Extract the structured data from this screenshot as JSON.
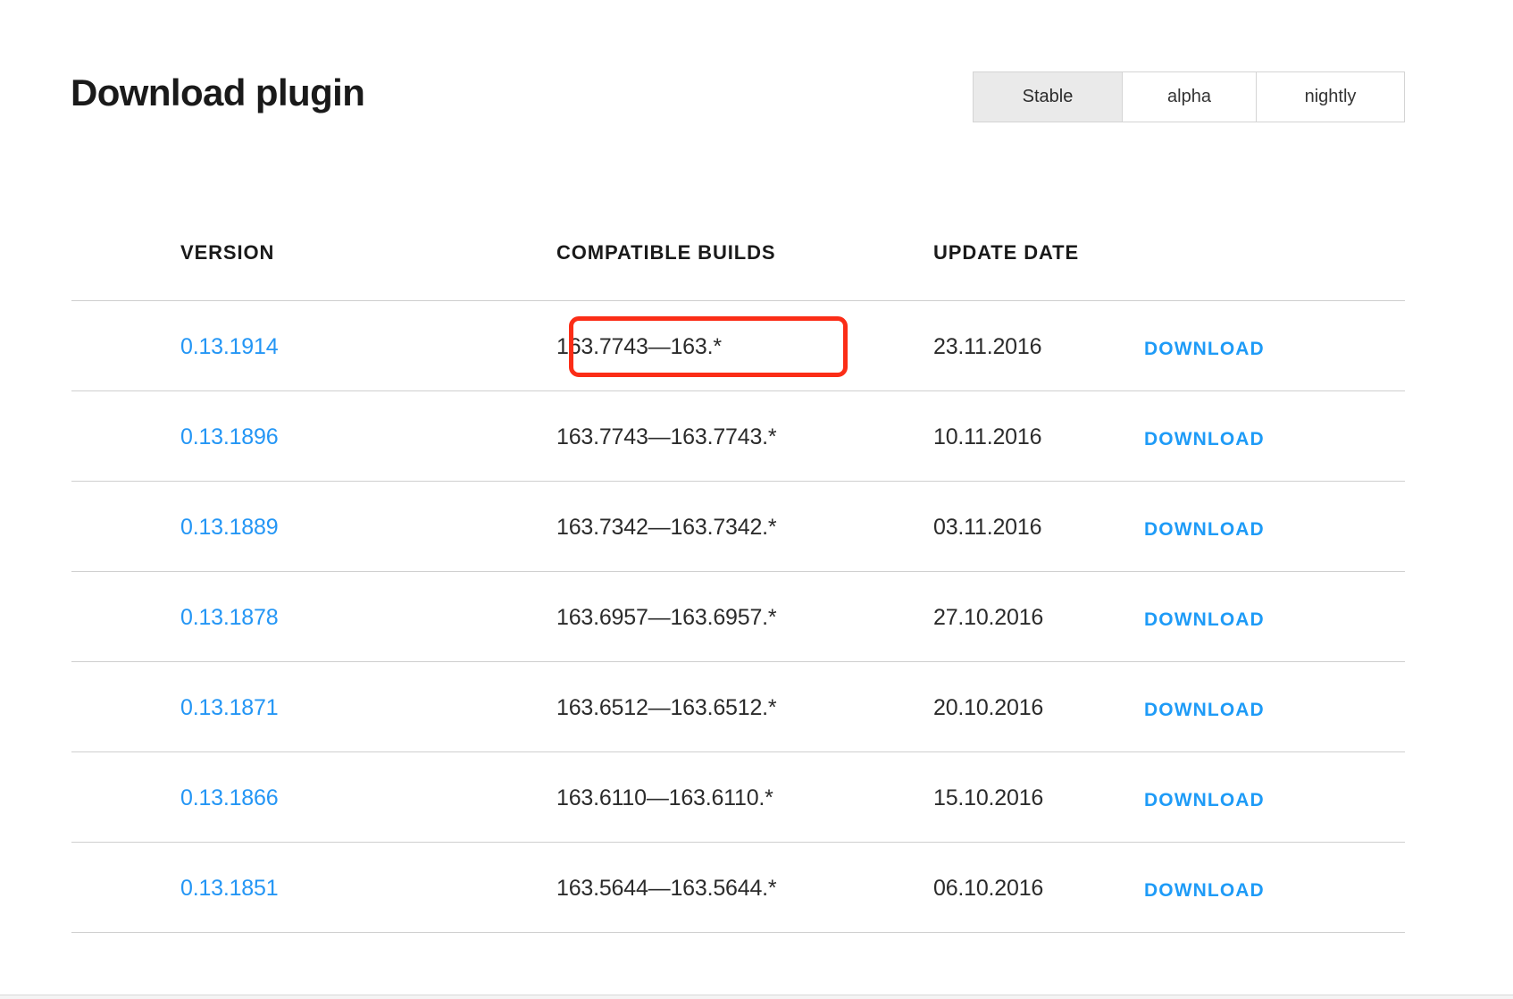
{
  "header": {
    "title": "Download plugin"
  },
  "channel_tabs": {
    "items": [
      {
        "label": "Stable",
        "active": true
      },
      {
        "label": "alpha",
        "active": false
      },
      {
        "label": "nightly",
        "active": false
      }
    ]
  },
  "table": {
    "columns": [
      "VERSION",
      "COMPATIBLE BUILDS",
      "UPDATE DATE"
    ],
    "action_label": "DOWNLOAD",
    "rows": [
      {
        "version": "0.13.1914",
        "compatible_builds": "163.7743—163.*",
        "update_date": "23.11.2016",
        "action": "DOWNLOAD",
        "highlighted": true
      },
      {
        "version": "0.13.1896",
        "compatible_builds": "163.7743—163.7743.*",
        "update_date": "10.11.2016",
        "action": "DOWNLOAD",
        "highlighted": false
      },
      {
        "version": "0.13.1889",
        "compatible_builds": "163.7342—163.7342.*",
        "update_date": "03.11.2016",
        "action": "DOWNLOAD",
        "highlighted": false
      },
      {
        "version": "0.13.1878",
        "compatible_builds": "163.6957—163.6957.*",
        "update_date": "27.10.2016",
        "action": "DOWNLOAD",
        "highlighted": false
      },
      {
        "version": "0.13.1871",
        "compatible_builds": "163.6512—163.6512.*",
        "update_date": "20.10.2016",
        "action": "DOWNLOAD",
        "highlighted": false
      },
      {
        "version": "0.13.1866",
        "compatible_builds": "163.6110—163.6110.*",
        "update_date": "15.10.2016",
        "action": "DOWNLOAD",
        "highlighted": false
      },
      {
        "version": "0.13.1851",
        "compatible_builds": "163.5644—163.5644.*",
        "update_date": "06.10.2016",
        "action": "DOWNLOAD",
        "highlighted": false
      }
    ]
  },
  "colors": {
    "link_blue": "#2496f5",
    "download_blue": "#1e9bf7",
    "text_dark": "#1a1a1a",
    "rule_gray": "#cfcfcf",
    "tab_active_bg": "#eaeaea",
    "highlight_red": "#fb2d17"
  }
}
